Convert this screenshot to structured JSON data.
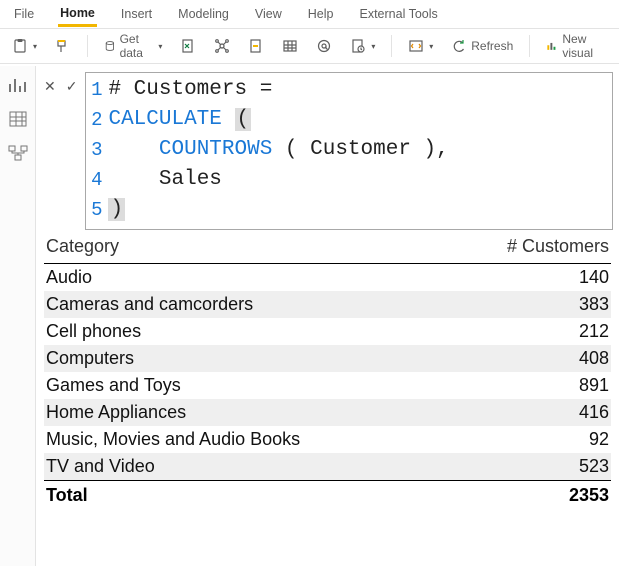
{
  "menu": {
    "items": [
      "File",
      "Home",
      "Insert",
      "Modeling",
      "View",
      "Help",
      "External Tools"
    ],
    "active_index": 1
  },
  "ribbon": {
    "get_data": "Get data",
    "refresh": "Refresh",
    "new_visual": "New visual"
  },
  "formula": {
    "lines": [
      {
        "n": "1",
        "plain": "# Customers =",
        "kw": ""
      },
      {
        "n": "2",
        "kw": "CALCULATE ",
        "paren": "("
      },
      {
        "n": "3",
        "indent": "    ",
        "kw": "COUNTROWS ",
        "tail": "( Customer ),"
      },
      {
        "n": "4",
        "indent": "    ",
        "plain": "Sales"
      },
      {
        "n": "5",
        "paren": ")"
      }
    ]
  },
  "table": {
    "header_category": "Category",
    "header_value": "# Customers",
    "rows": [
      {
        "category": "Audio",
        "value": "140"
      },
      {
        "category": "Cameras and camcorders",
        "value": "383"
      },
      {
        "category": "Cell phones",
        "value": "212"
      },
      {
        "category": "Computers",
        "value": "408"
      },
      {
        "category": "Games and Toys",
        "value": "891"
      },
      {
        "category": "Home Appliances",
        "value": "416"
      },
      {
        "category": "Music, Movies and Audio Books",
        "value": "92"
      },
      {
        "category": "TV and Video",
        "value": "523"
      }
    ],
    "total_label": "Total",
    "total_value": "2353"
  },
  "chart_data": {
    "type": "table",
    "title": "# Customers by Category",
    "columns": [
      "Category",
      "# Customers"
    ],
    "rows": [
      [
        "Audio",
        140
      ],
      [
        "Cameras and camcorders",
        383
      ],
      [
        "Cell phones",
        212
      ],
      [
        "Computers",
        408
      ],
      [
        "Games and Toys",
        891
      ],
      [
        "Home Appliances",
        416
      ],
      [
        "Music, Movies and Audio Books",
        92
      ],
      [
        "TV and Video",
        523
      ]
    ],
    "total": 2353
  }
}
